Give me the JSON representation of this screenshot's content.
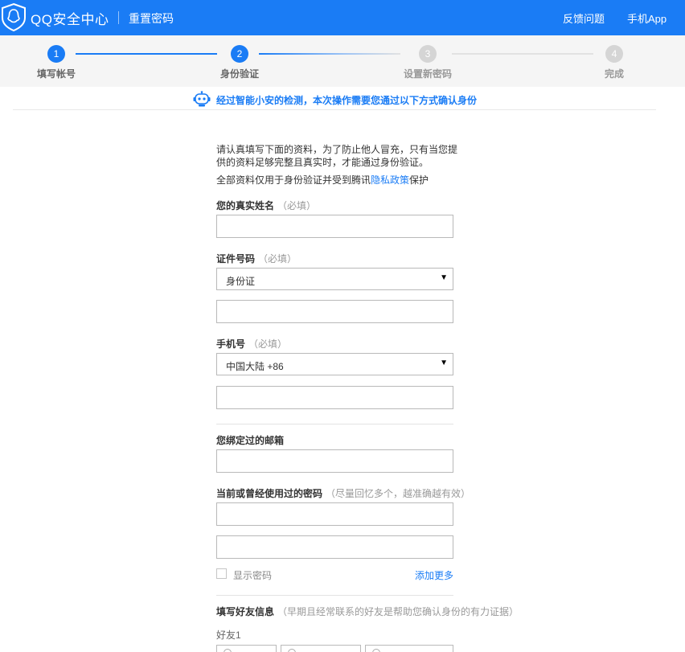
{
  "header": {
    "brand": "QQ安全中心",
    "page_name": "重置密码",
    "links": {
      "feedback": "反馈问题",
      "app": "手机App"
    }
  },
  "steps": [
    {
      "number": "1",
      "label": "填写帐号",
      "state": "done"
    },
    {
      "number": "2",
      "label": "身份验证",
      "state": "current"
    },
    {
      "number": "3",
      "label": "设置新密码",
      "state": "pending"
    },
    {
      "number": "4",
      "label": "完成",
      "state": "pending"
    }
  ],
  "notice": {
    "text": "经过智能小安的检测，本次操作需要您通过以下方式确认身份"
  },
  "intro": {
    "line1": "请认真填写下面的资料，为了防止他人冒充，只有当您提供的资料足够完整且真实时，才能通过身份验证。",
    "line2_prefix": "全部资料仅用于身份验证并受到腾讯",
    "privacy_link": "隐私政策",
    "line2_suffix": "保护"
  },
  "form": {
    "name": {
      "label": "您的真实姓名",
      "hint": "（必填）",
      "value": ""
    },
    "id": {
      "label": "证件号码",
      "hint": "（必填）",
      "type_selected": "身份证",
      "value": ""
    },
    "phone": {
      "label": "手机号",
      "hint": "（必填）",
      "region_selected": "中国大陆 +86",
      "value": ""
    },
    "email": {
      "label": "您绑定过的邮箱",
      "value": ""
    },
    "password": {
      "label": "当前或曾经使用过的密码",
      "hint": "（尽量回忆多个，越准确越有效）",
      "value_1": "",
      "value_2": "",
      "show_password_label": "显示密码",
      "show_password_checked": false,
      "add_more": "添加更多"
    },
    "friends": {
      "label": "填写好友信息",
      "hint": "（早期且经常联系的好友是帮助您确认身份的有力证据）",
      "friend_1_label": "好友1"
    }
  },
  "icons": {
    "logo": "qq-penguin-shield-icon",
    "robot": "robot-assistant-icon",
    "select_arrow": "▼"
  },
  "colors": {
    "primary": "#1a7cf5",
    "step_inactive": "#d5d5d5"
  }
}
